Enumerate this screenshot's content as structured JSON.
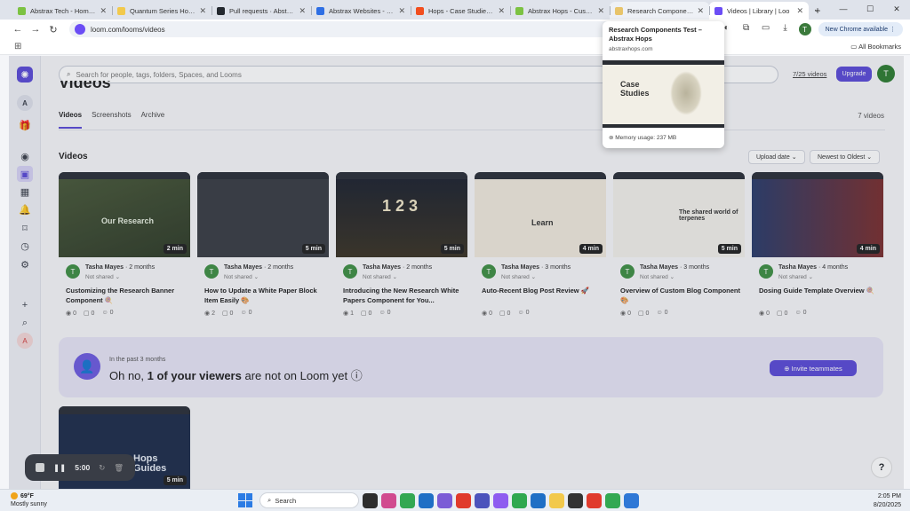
{
  "browser": {
    "tabs": [
      {
        "title": "Abstrax Tech - Home - Sh",
        "favicon_color": "#7cc242"
      },
      {
        "title": "Quantum Series Hop Extr",
        "favicon_color": "#f2c94c"
      },
      {
        "title": "Pull requests · Abstrax-Te",
        "favicon_color": "#24292f"
      },
      {
        "title": "Abstrax Websites - Backl",
        "favicon_color": "#2f6fe4"
      },
      {
        "title": "Hops - Case Studies Page",
        "favicon_color": "#f24e1e"
      },
      {
        "title": "Abstrax Hops - Customiz",
        "favicon_color": "#7cc242"
      },
      {
        "title": "Research Components Te",
        "favicon_color": "#e8c46a"
      },
      {
        "title": "Videos | Library | Loo",
        "favicon_color": "#6b4df5"
      }
    ],
    "new_tab_label": "+",
    "url": "loom.com/looms/videos",
    "new_chrome_label": "New Chrome available",
    "profile_initial": "T",
    "all_bookmarks_label": "All Bookmarks"
  },
  "hover_card": {
    "title": "Research Components Test – Abstrax Hops",
    "domain": "abstraxhops.com",
    "preview_heading": "Case Studies",
    "memory": "Memory usage: 237 MB"
  },
  "loom": {
    "search_placeholder": "Search for people, tags, folders, Spaces, and Looms",
    "video_quota": "7/25 videos",
    "upgrade_label": "Upgrade",
    "user_initial": "T",
    "workspace_initial": "A",
    "page_title": "Videos",
    "tabs": [
      "Videos",
      "Screenshots",
      "Archive"
    ],
    "videos_count": "7 videos",
    "section_title": "Videos",
    "sort_by": "Upload date",
    "sort_order": "Newest to Oldest",
    "cards": [
      {
        "duration": "2 min",
        "thumb_text": "Our Research",
        "author": "Tasha Mayes",
        "age": "· 2 months",
        "shared": "Not shared",
        "title": "Customizing the Research Banner Component 🍭",
        "views": "0",
        "comments": "0",
        "reactions": "0"
      },
      {
        "duration": "5 min",
        "thumb_text": "",
        "author": "Tasha Mayes",
        "age": "· 2 months",
        "shared": "Not shared",
        "title": "How to Update a White Paper Block Item Easily 🎨",
        "views": "2",
        "comments": "0",
        "reactions": "0"
      },
      {
        "duration": "5 min",
        "thumb_text": "1 2 3",
        "author": "Tasha Mayes",
        "age": "· 2 months",
        "shared": "Not shared",
        "title": "Introducing the New Research White Papers Component for You...",
        "views": "1",
        "comments": "0",
        "reactions": "0"
      },
      {
        "duration": "4 min",
        "thumb_text": "Learn",
        "author": "Tasha Mayes",
        "age": "· 3 months",
        "shared": "Not shared",
        "title": "Auto-Recent Blog Post Review 🚀",
        "views": "0",
        "comments": "0",
        "reactions": "0"
      },
      {
        "duration": "5 min",
        "thumb_text": "The shared world of terpenes",
        "author": "Tasha Mayes",
        "age": "· 3 months",
        "shared": "Not shared",
        "title": "Overview of Custom Blog Component 🎨",
        "views": "0",
        "comments": "0",
        "reactions": "0"
      },
      {
        "duration": "4 min",
        "thumb_text": "",
        "author": "Tasha Mayes",
        "age": "· 4 months",
        "shared": "Not shared",
        "title": "Dosing Guide Template Overview 🍭",
        "views": "0",
        "comments": "0",
        "reactions": "0"
      }
    ],
    "banner": {
      "subtitle": "In the past 3 months",
      "message_prefix": "Oh no, ",
      "message_bold": "1 of your viewers",
      "message_suffix": " are not on Loom yet ⓘ",
      "invite_label": "Invite teammates"
    },
    "card7": {
      "thumb_text": "Hops Guides",
      "duration": "5 min"
    },
    "recorder_time": "5:00",
    "help_label": "?"
  },
  "taskbar": {
    "temperature": "69°F",
    "weather": "Mostly sunny",
    "search_label": "Search",
    "time": "2:05 PM",
    "date": "8/20/2025",
    "app_colors": [
      "#2d2d2d",
      "#d14b8f",
      "#33a852",
      "#1f6fc5",
      "#7b5cd6",
      "#e03b2d",
      "#4b53bc",
      "#8e5cf0",
      "#2fa84f",
      "#1f6fc5",
      "#f2c94c",
      "#333333",
      "#e03b2d",
      "#33a852",
      "#2f78d6"
    ]
  }
}
